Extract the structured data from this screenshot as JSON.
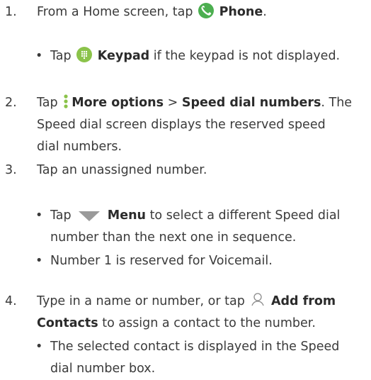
{
  "steps": [
    {
      "num": "1.",
      "pre": "From a Home screen, tap",
      "b1": "Phone",
      "post": "."
    },
    {
      "num": "2.",
      "pre": "Tap",
      "b1": "More options",
      "sep": " > ",
      "b2": "Speed dial numbers",
      "post": ". The",
      "line2": "Speed dial screen displays the reserved speed",
      "line3": "dial numbers."
    },
    {
      "num": "3.",
      "text": "Tap an unassigned number."
    },
    {
      "num": "4.",
      "pre": "Type in a name or number, or tap",
      "b1": "Add from",
      "b1b": "Contacts",
      "post": " to assign a contact to the number."
    }
  ],
  "bullets": {
    "b1": {
      "pre": "Tap",
      "bold": "Keypad",
      "post": " if the keypad is not displayed."
    },
    "b2": {
      "pre": "Tap",
      "bold": "Menu",
      "post": " to select a different Speed dial",
      "line2": "number than the next one in sequence."
    },
    "b3": {
      "text": "Number 1 is reserved for Voicemail."
    },
    "b4": {
      "text": "The selected contact is displayed in the Speed",
      "line2": "dial number box."
    }
  },
  "icons": {
    "phone": "phone-icon",
    "keypad": "keypad-icon",
    "more": "more-options-icon",
    "menu": "menu-triangle-icon",
    "contact": "contact-icon"
  }
}
